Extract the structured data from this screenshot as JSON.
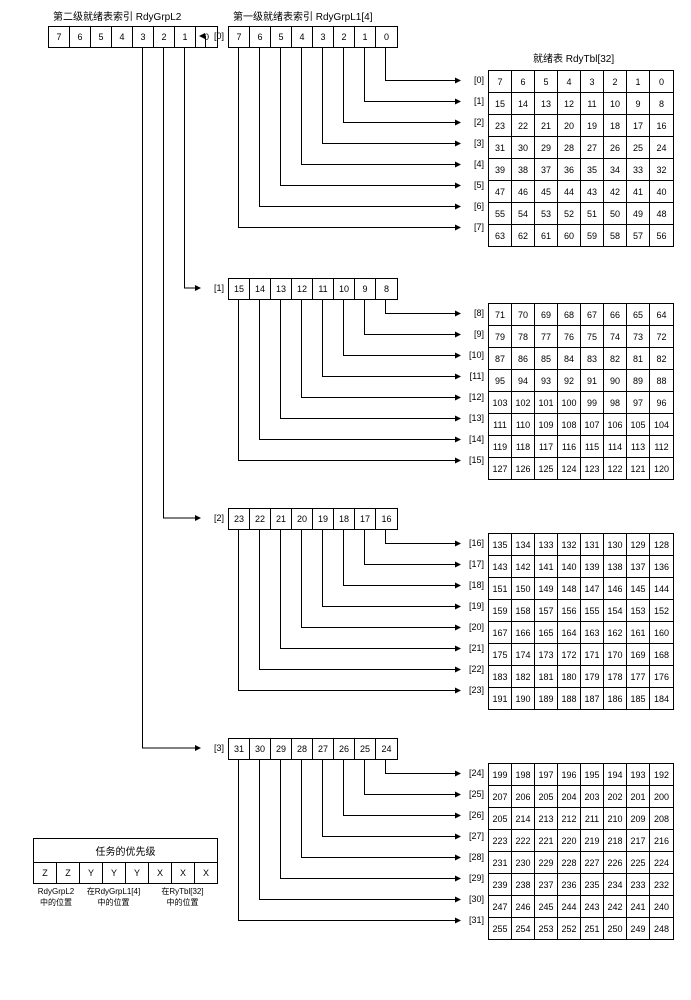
{
  "titles": {
    "l2": "第二级就绪表索引 RdyGrpL2",
    "l1": "第一级就绪表索引 RdyGrpL1[4]",
    "tbl": "就绪表 RdyTbl[32]",
    "priority": "任务的优先级"
  },
  "l2_cells": [
    "7",
    "6",
    "5",
    "4",
    "3",
    "2",
    "1",
    "0"
  ],
  "l1_groups": [
    {
      "idx": "[0]",
      "cells": [
        "7",
        "6",
        "5",
        "4",
        "3",
        "2",
        "1",
        "0"
      ]
    },
    {
      "idx": "[1]",
      "cells": [
        "15",
        "14",
        "13",
        "12",
        "11",
        "10",
        "9",
        "8"
      ]
    },
    {
      "idx": "[2]",
      "cells": [
        "23",
        "22",
        "21",
        "20",
        "19",
        "18",
        "17",
        "16"
      ]
    },
    {
      "idx": "[3]",
      "cells": [
        "31",
        "30",
        "29",
        "28",
        "27",
        "26",
        "25",
        "24"
      ]
    }
  ],
  "rdy_rows": [
    {
      "idx": "[0]",
      "cells": [
        "7",
        "6",
        "5",
        "4",
        "3",
        "2",
        "1",
        "0"
      ]
    },
    {
      "idx": "[1]",
      "cells": [
        "15",
        "14",
        "13",
        "12",
        "11",
        "10",
        "9",
        "8"
      ]
    },
    {
      "idx": "[2]",
      "cells": [
        "23",
        "22",
        "21",
        "20",
        "19",
        "18",
        "17",
        "16"
      ]
    },
    {
      "idx": "[3]",
      "cells": [
        "31",
        "30",
        "29",
        "28",
        "27",
        "26",
        "25",
        "24"
      ]
    },
    {
      "idx": "[4]",
      "cells": [
        "39",
        "38",
        "37",
        "36",
        "35",
        "34",
        "33",
        "32"
      ]
    },
    {
      "idx": "[5]",
      "cells": [
        "47",
        "46",
        "45",
        "44",
        "43",
        "42",
        "41",
        "40"
      ]
    },
    {
      "idx": "[6]",
      "cells": [
        "55",
        "54",
        "53",
        "52",
        "51",
        "50",
        "49",
        "48"
      ]
    },
    {
      "idx": "[7]",
      "cells": [
        "63",
        "62",
        "61",
        "60",
        "59",
        "58",
        "57",
        "56"
      ]
    },
    {
      "idx": "[8]",
      "cells": [
        "71",
        "70",
        "69",
        "68",
        "67",
        "66",
        "65",
        "64"
      ]
    },
    {
      "idx": "[9]",
      "cells": [
        "79",
        "78",
        "77",
        "76",
        "75",
        "74",
        "73",
        "72"
      ]
    },
    {
      "idx": "[10]",
      "cells": [
        "87",
        "86",
        "85",
        "84",
        "83",
        "82",
        "81",
        "82"
      ]
    },
    {
      "idx": "[11]",
      "cells": [
        "95",
        "94",
        "93",
        "92",
        "91",
        "90",
        "89",
        "88"
      ]
    },
    {
      "idx": "[12]",
      "cells": [
        "103",
        "102",
        "101",
        "100",
        "99",
        "98",
        "97",
        "96"
      ]
    },
    {
      "idx": "[13]",
      "cells": [
        "111",
        "110",
        "109",
        "108",
        "107",
        "106",
        "105",
        "104"
      ]
    },
    {
      "idx": "[14]",
      "cells": [
        "119",
        "118",
        "117",
        "116",
        "115",
        "114",
        "113",
        "112"
      ]
    },
    {
      "idx": "[15]",
      "cells": [
        "127",
        "126",
        "125",
        "124",
        "123",
        "122",
        "121",
        "120"
      ]
    },
    {
      "idx": "[16]",
      "cells": [
        "135",
        "134",
        "133",
        "132",
        "131",
        "130",
        "129",
        "128"
      ]
    },
    {
      "idx": "[17]",
      "cells": [
        "143",
        "142",
        "141",
        "140",
        "139",
        "138",
        "137",
        "136"
      ]
    },
    {
      "idx": "[18]",
      "cells": [
        "151",
        "150",
        "149",
        "148",
        "147",
        "146",
        "145",
        "144"
      ]
    },
    {
      "idx": "[19]",
      "cells": [
        "159",
        "158",
        "157",
        "156",
        "155",
        "154",
        "153",
        "152"
      ]
    },
    {
      "idx": "[20]",
      "cells": [
        "167",
        "166",
        "165",
        "164",
        "163",
        "162",
        "161",
        "160"
      ]
    },
    {
      "idx": "[21]",
      "cells": [
        "175",
        "174",
        "173",
        "172",
        "171",
        "170",
        "169",
        "168"
      ]
    },
    {
      "idx": "[22]",
      "cells": [
        "183",
        "182",
        "181",
        "180",
        "179",
        "178",
        "177",
        "176"
      ]
    },
    {
      "idx": "[23]",
      "cells": [
        "191",
        "190",
        "189",
        "188",
        "187",
        "186",
        "185",
        "184"
      ]
    },
    {
      "idx": "[24]",
      "cells": [
        "199",
        "198",
        "197",
        "196",
        "195",
        "194",
        "193",
        "192"
      ]
    },
    {
      "idx": "[25]",
      "cells": [
        "207",
        "206",
        "205",
        "204",
        "203",
        "202",
        "201",
        "200"
      ]
    },
    {
      "idx": "[26]",
      "cells": [
        "205",
        "214",
        "213",
        "212",
        "211",
        "210",
        "209",
        "208"
      ]
    },
    {
      "idx": "[27]",
      "cells": [
        "223",
        "222",
        "221",
        "220",
        "219",
        "218",
        "217",
        "216"
      ]
    },
    {
      "idx": "[28]",
      "cells": [
        "231",
        "230",
        "229",
        "228",
        "227",
        "226",
        "225",
        "224"
      ]
    },
    {
      "idx": "[29]",
      "cells": [
        "239",
        "238",
        "237",
        "236",
        "235",
        "234",
        "233",
        "232"
      ]
    },
    {
      "idx": "[30]",
      "cells": [
        "247",
        "246",
        "245",
        "244",
        "243",
        "242",
        "241",
        "240"
      ]
    },
    {
      "idx": "[31]",
      "cells": [
        "255",
        "254",
        "253",
        "252",
        "251",
        "250",
        "249",
        "248"
      ]
    }
  ],
  "priority_cells": [
    "Z",
    "Z",
    "Y",
    "Y",
    "Y",
    "X",
    "X",
    "X"
  ],
  "priority_labels": [
    {
      "text": "RdyGrpL2\n中的位置",
      "span": 2
    },
    {
      "text": "在RdyGrpL1[4]\n中的位置",
      "span": 3
    },
    {
      "text": "在RyTbl[32]\n中的位置",
      "span": 3
    }
  ]
}
